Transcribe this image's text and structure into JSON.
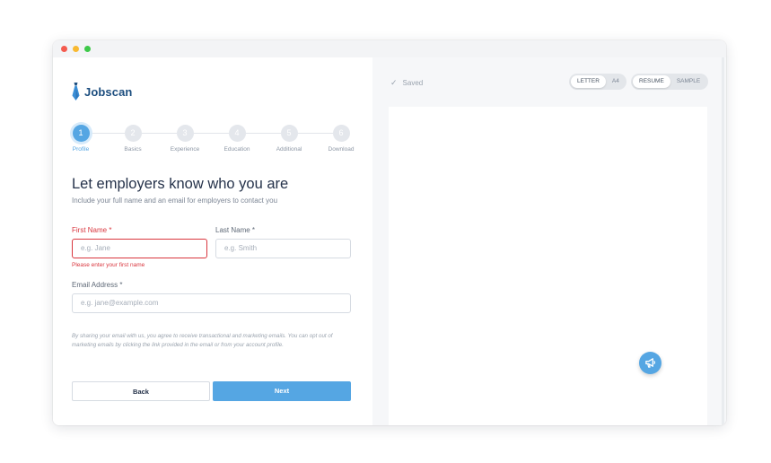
{
  "brand": {
    "name": "Jobscan"
  },
  "steps": [
    {
      "number": "1",
      "label": "Profile",
      "active": true
    },
    {
      "number": "2",
      "label": "Basics",
      "active": false
    },
    {
      "number": "3",
      "label": "Experience",
      "active": false
    },
    {
      "number": "4",
      "label": "Education",
      "active": false
    },
    {
      "number": "5",
      "label": "Additional",
      "active": false
    },
    {
      "number": "6",
      "label": "Download",
      "active": false
    }
  ],
  "form": {
    "heading": "Let employers know who you are",
    "subheading": "Include your full name and an email for employers to contact you",
    "first_name": {
      "label": "First Name *",
      "placeholder": "e.g. Jane",
      "value": "",
      "error": "Please enter your first name"
    },
    "last_name": {
      "label": "Last Name *",
      "placeholder": "e.g. Smith",
      "value": ""
    },
    "email": {
      "label": "Email Address *",
      "placeholder": "e.g. jane@example.com",
      "value": ""
    },
    "disclaimer": "By sharing your email with us, you agree to receive transactional and marketing emails. You can opt out of marketing emails by clicking the link provided in the email or from your account profile.",
    "back_label": "Back",
    "next_label": "Next"
  },
  "preview": {
    "status": "Saved",
    "paper_options": [
      "LETTER",
      "A4"
    ],
    "paper_selected": "LETTER",
    "mode_options": [
      "RESUME",
      "SAMPLE"
    ],
    "mode_selected": "RESUME"
  },
  "icons": {
    "status": "check-icon",
    "feedback": "megaphone-icon",
    "logo": "tie-icon"
  },
  "colors": {
    "accent": "#55a6e3",
    "error": "#d9363e",
    "brand": "#1d4e7f"
  }
}
